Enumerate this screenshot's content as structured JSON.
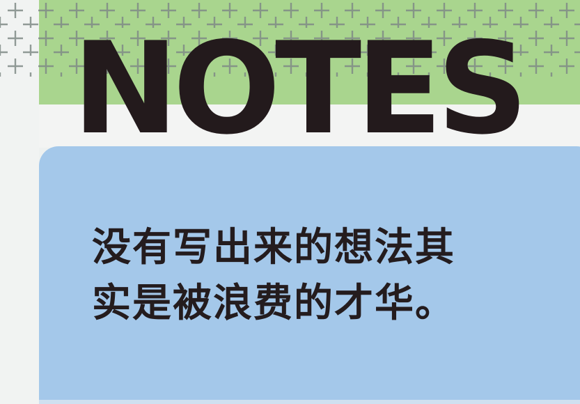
{
  "header": {
    "title": "NOTES"
  },
  "note": {
    "lines": [
      "没有写出来的想法其",
      "实是被浪费的才华。"
    ]
  },
  "colors": {
    "green_band": "#a9d58e",
    "card_blue": "#a4c8ea",
    "text_dark": "#231a1c",
    "background": "#eef1f0"
  },
  "icons": {
    "pattern": "cross-pattern-icon"
  }
}
